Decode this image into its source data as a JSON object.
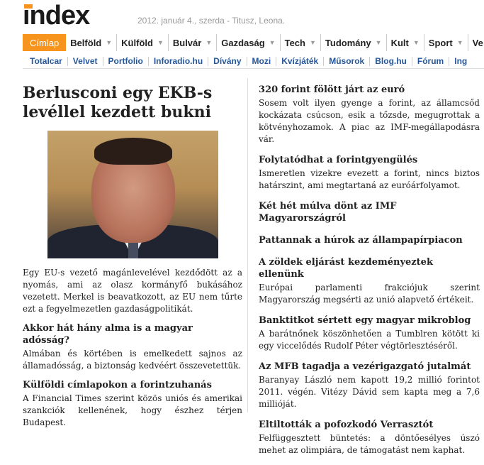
{
  "header": {
    "logo": "index",
    "dateline": "2012. január  4., szerda - Titusz, Leona."
  },
  "nav": [
    {
      "label": "Címlap",
      "active": true
    },
    {
      "label": "Belföld"
    },
    {
      "label": "Külföld"
    },
    {
      "label": "Bulvár"
    },
    {
      "label": "Gazdaság"
    },
    {
      "label": "Tech"
    },
    {
      "label": "Tudomány"
    },
    {
      "label": "Kult"
    },
    {
      "label": "Sport"
    },
    {
      "label": "Ve"
    }
  ],
  "subnav": [
    "Totalcar",
    "Velvet",
    "Portfolio",
    "Inforadio.hu",
    "Dívány",
    "Mozi",
    "Kvízjáték",
    "Műsorok",
    "Blog.hu",
    "Fórum",
    "Ing"
  ],
  "main": {
    "title": "Berlusconi egy EKB-s levéllel kezdett bukni",
    "lead": "Egy EU-s vezető magánlevelével kezdődött az a nyomás, ami az olasz kormányfő bukásához vezetett. Merkel is beavatkozott, az EU nem tűrte ezt a fegyelmezetlen gazdaságpolitikát.",
    "items": [
      {
        "title": "Akkor hát hány alma is a magyar adósság?",
        "text": "Almában és körtében is emelkedett sajnos az államadósság, a biztonság kedvéért összevetettük."
      },
      {
        "title": "Külföldi címlapokon a forintzuhanás",
        "text": "A Financial Times szerint közös uniós és amerikai szankciók kellenének, hogy észhez térjen Budapest."
      }
    ]
  },
  "right": [
    {
      "title": "320 forint fölött járt az euró",
      "text": "Sosem volt ilyen gyenge a forint, az államcsőd kockázata csúcson, esik a tőzsde, megugrottak a kötvényhozamok. A piac az IMF-megállapodásra vár."
    },
    {
      "title": "Folytatódhat a forintgyengülés",
      "text": "Ismeretlen vizekre evezett a forint, nincs biztos határszint, ami megtartaná az euróárfolyamot."
    },
    {
      "title": "Két hét múlva dönt az IMF Magyarországról",
      "text": ""
    },
    {
      "title": "Pattannak a húrok az állampapírpiacon",
      "text": ""
    },
    {
      "title": "A zöldek eljárást kezdeményeztek ellenünk",
      "text": "Európai parlamenti frakciójuk szerint Magyarország megsérti az unió alapvető értékeit."
    },
    {
      "title": "Banktitkot sértett egy magyar mikroblog",
      "text": "A barátnőnek köszönhetően a Tumblren kötött ki egy viccelődés Rudolf Péter végtörlesztéséről."
    },
    {
      "title": "Az MFB tagadja a vezérigazgató jutalmát",
      "text": "Baranyay László nem kapott 19,2 millió forintot 2011. végén. Vitézy Dávid sem kapta meg a 7,6 millióját."
    },
    {
      "title": "Eltiltották a pofozkodó Verrasztót",
      "text": "Felfüggesztett büntetés: a döntőesélyes úszó mehet az olimpiára, de támogatást nem kaphat."
    }
  ]
}
